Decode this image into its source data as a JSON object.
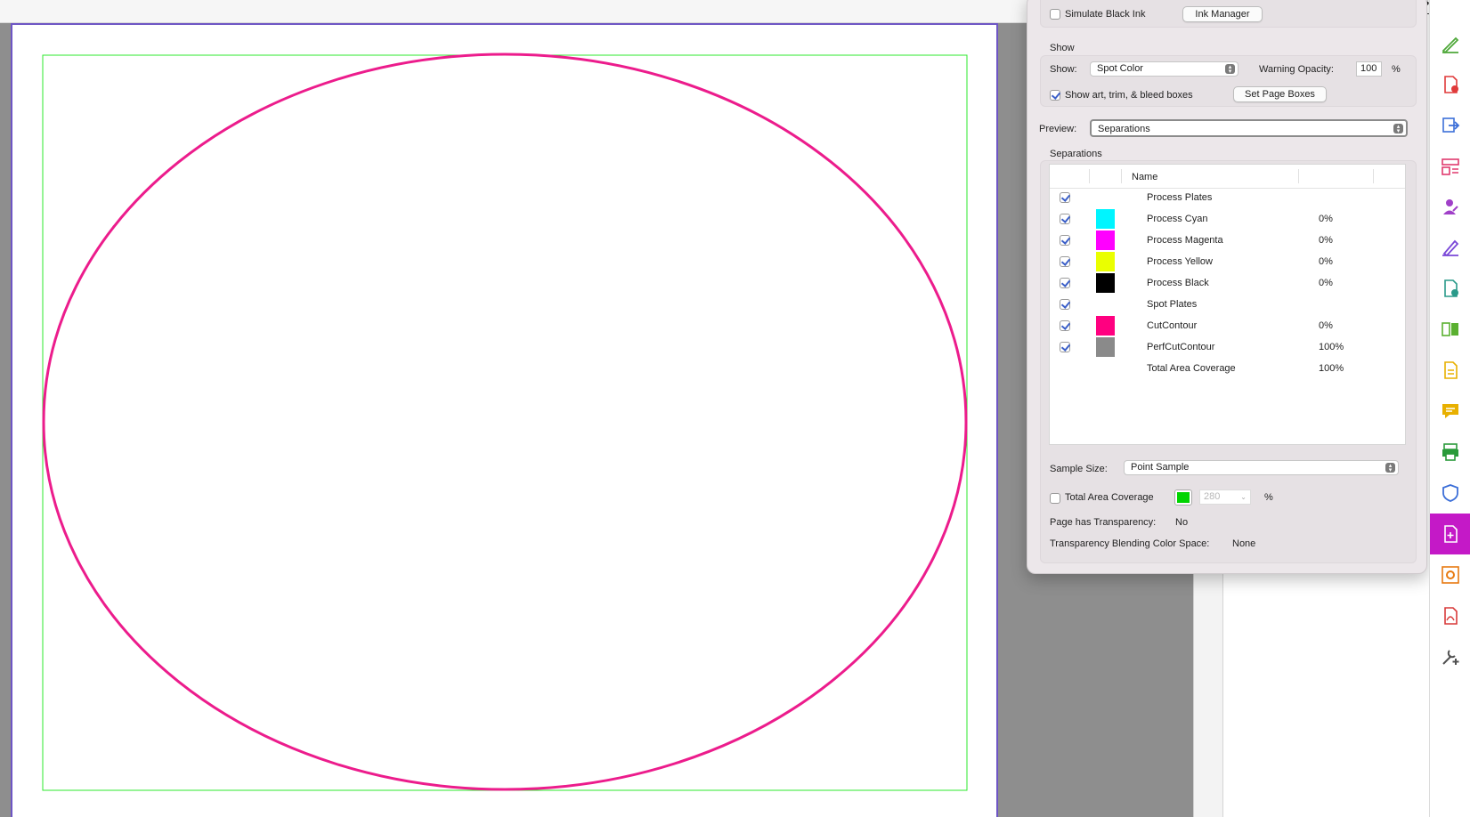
{
  "top_button": {
    "label": "se"
  },
  "dialog": {
    "simulate_black_ink": {
      "label": "Simulate Black Ink",
      "checked": false
    },
    "ink_manager_button": "Ink Manager",
    "show_group": {
      "title": "Show",
      "show_label": "Show:",
      "show_value": "Spot Color",
      "warning_opacity_label": "Warning Opacity:",
      "warning_opacity_value": "100",
      "warning_opacity_unit": "%",
      "show_boxes": {
        "label": "Show art, trim, & bleed boxes",
        "checked": true
      },
      "set_page_boxes_button": "Set Page Boxes"
    },
    "preview_label": "Preview:",
    "preview_value": "Separations",
    "separations": {
      "title": "Separations",
      "column_name": "Name",
      "rows": [
        {
          "name": "Process Plates",
          "pct": "",
          "checked": true,
          "swatch": ""
        },
        {
          "name": "Process Cyan",
          "pct": "0%",
          "checked": true,
          "swatch": "#00f5ff"
        },
        {
          "name": "Process Magenta",
          "pct": "0%",
          "checked": true,
          "swatch": "#ff00ff"
        },
        {
          "name": "Process Yellow",
          "pct": "0%",
          "checked": true,
          "swatch": "#eaff00"
        },
        {
          "name": "Process Black",
          "pct": "0%",
          "checked": true,
          "swatch": "#000000"
        },
        {
          "name": "Spot Plates",
          "pct": "",
          "checked": true,
          "swatch": ""
        },
        {
          "name": "CutContour",
          "pct": "0%",
          "checked": true,
          "swatch": "#ff0080"
        },
        {
          "name": "PerfCutContour",
          "pct": "100%",
          "checked": true,
          "swatch": "#8a8a8a"
        },
        {
          "name": "Total Area Coverage",
          "pct": "100%",
          "checked": null,
          "swatch": ""
        }
      ]
    },
    "sample_size_label": "Sample Size:",
    "sample_size_value": "Point Sample",
    "total_area_coverage": {
      "label": "Total Area Coverage",
      "checked": false,
      "color": "#00d400",
      "value": "280",
      "unit": "%"
    },
    "page_has_transparency_label": "Page has Transparency:",
    "page_has_transparency_value": "No",
    "blending_space_label": "Transparency Blending Color Space:",
    "blending_space_value": "None"
  },
  "tool_rail": [
    {
      "icon": "pencil-edit-icon",
      "color": "#4fa83a"
    },
    {
      "icon": "create-pdf-icon",
      "color": "#e03a3a"
    },
    {
      "icon": "export-pdf-icon",
      "color": "#3c6fd8"
    },
    {
      "icon": "organize-pages-icon",
      "color": "#e03a6e"
    },
    {
      "icon": "request-signature-icon",
      "color": "#a040c8"
    },
    {
      "icon": "fill-sign-icon",
      "color": "#7a48d8"
    },
    {
      "icon": "send-for-review-icon",
      "color": "#2a9a8a"
    },
    {
      "icon": "compare-files-icon",
      "color": "#5ab030"
    },
    {
      "icon": "scan-ocr-icon",
      "color": "#e8b000"
    },
    {
      "icon": "comment-icon",
      "color": "#e8b000"
    },
    {
      "icon": "print-production-icon",
      "color": "#2a9a3a"
    },
    {
      "icon": "protect-icon",
      "color": "#3c6fd8"
    },
    {
      "icon": "output-preview-icon",
      "color": "#ffffff",
      "active": true
    },
    {
      "icon": "preflight-icon",
      "color": "#e87a10"
    },
    {
      "icon": "pdf-standards-icon",
      "color": "#d83a3a"
    },
    {
      "icon": "more-tools-icon",
      "color": "#505050"
    }
  ],
  "colors": {
    "page_ellipse": "#ec1c8c",
    "trim_box": "#2ee82e",
    "page_border": "#6e56c4",
    "active_tool": "#c419c7"
  }
}
